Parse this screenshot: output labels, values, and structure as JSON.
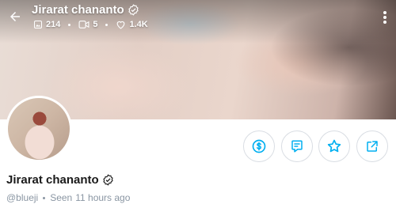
{
  "header": {
    "title": "Jirarat chananto",
    "verified_icon": "verified-check-icon",
    "stats": {
      "photos": "214",
      "videos": "5",
      "likes": "1.4K"
    }
  },
  "profile": {
    "name": "Jirarat chananto",
    "username": "@blueji",
    "seen_label": "Seen",
    "seen_time": "11 hours ago"
  },
  "actions": [
    {
      "name": "tip",
      "icon": "dollar-icon"
    },
    {
      "name": "message",
      "icon": "message-icon"
    },
    {
      "name": "favorite",
      "icon": "star-icon"
    },
    {
      "name": "share",
      "icon": "share-icon"
    }
  ],
  "colors": {
    "accent": "#00aff0",
    "muted": "#8a96a3",
    "text": "#1a1a1a"
  }
}
